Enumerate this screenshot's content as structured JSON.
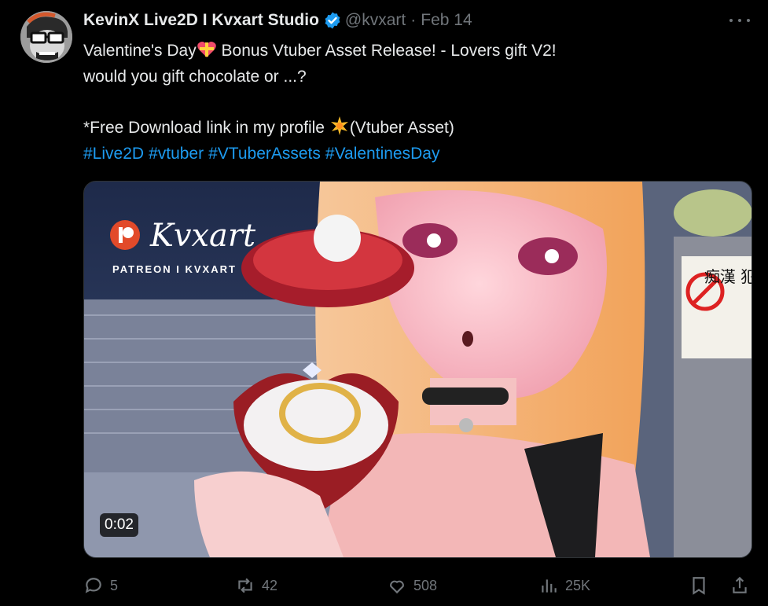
{
  "tweet": {
    "author_name": "KevinX Live2D I Kvxart Studio",
    "handle": "@kvxart",
    "separator": "·",
    "date": "Feb 14",
    "text_line1": "Valentine's Day",
    "text_line1b": "Bonus Vtuber Asset Release! - Lovers gift V2!",
    "text_line2": "would you gift chocolate or ...?",
    "text_line3a": "*Free Download link in my profile",
    "text_line3b": "(Vtuber Asset)",
    "hashtags": [
      "#Live2D",
      "#vtuber",
      "#VTuberAssets",
      "#ValentinesDay"
    ]
  },
  "media": {
    "video_time": "0:02",
    "brand_text": "Kvxart",
    "brand_caption": "PATREON I KVXART",
    "sign_text": "痴漢 犯罪"
  },
  "actions": {
    "replies": "5",
    "retweets": "42",
    "likes": "508",
    "views": "25K"
  },
  "colors": {
    "background": "#000000",
    "text": "#e7e9ea",
    "muted": "#71767b",
    "link": "#1d9bf0",
    "verified": "#1d9bf0"
  }
}
